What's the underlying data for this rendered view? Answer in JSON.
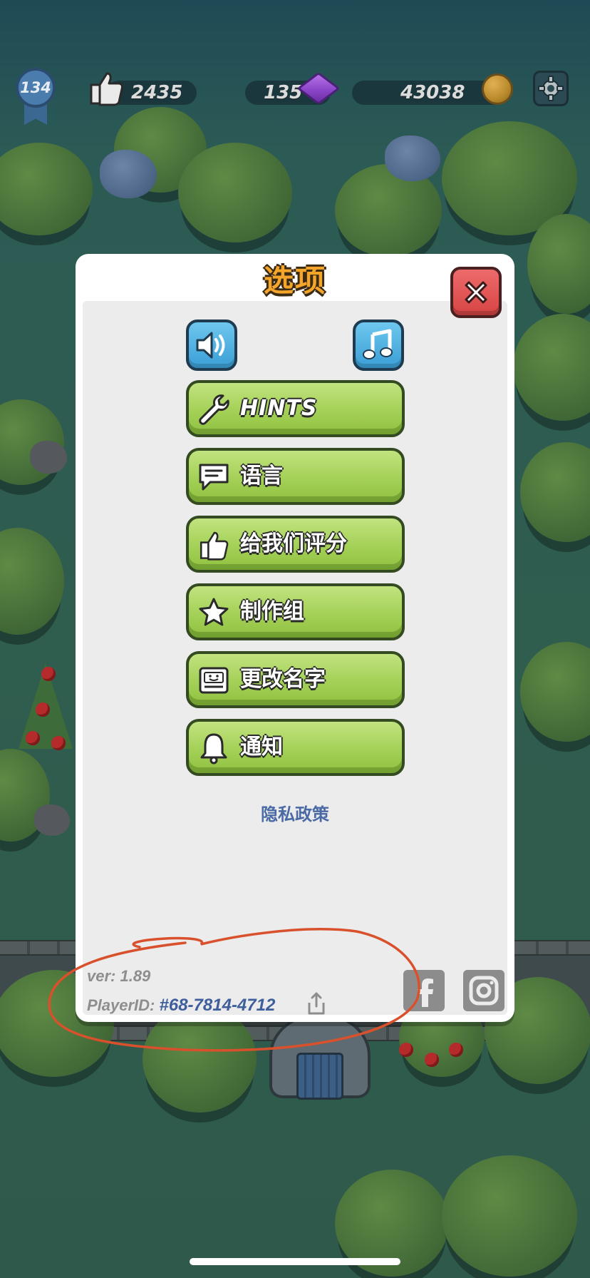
{
  "hud": {
    "level": "134",
    "likes": "2435",
    "gems": "135",
    "coins": "43038",
    "icons": [
      "level-badge-icon",
      "thumbs-up-icon",
      "gem-icon",
      "coin-icon",
      "gear-icon"
    ]
  },
  "dialog": {
    "title": "选项",
    "close_icon": "close-icon",
    "sound_icon": "speaker-icon",
    "music_icon": "music-note-icon",
    "buttons": [
      {
        "label": "HINTS",
        "icon": "wrench-icon"
      },
      {
        "label": "语言",
        "icon": "speech-bubble-icon"
      },
      {
        "label": "给我们评分",
        "icon": "thumbs-up-icon"
      },
      {
        "label": "制作组",
        "icon": "star-icon"
      },
      {
        "label": "更改名字",
        "icon": "name-card-icon"
      },
      {
        "label": "通知",
        "icon": "bell-icon"
      }
    ],
    "privacy_link": "隐私政策",
    "version": "ver: 1.89",
    "player_id_label": "PlayerID:",
    "player_id_value": "#68-7814-4712",
    "social": [
      "facebook-icon",
      "instagram-icon"
    ]
  },
  "colors": {
    "button_green": "#a6d25a",
    "title_orange": "#f4a52a",
    "close_red": "#d64444",
    "sound_blue": "#3a9ed6",
    "annotation_red": "#d9512c",
    "link_blue": "#4a6aa6"
  }
}
